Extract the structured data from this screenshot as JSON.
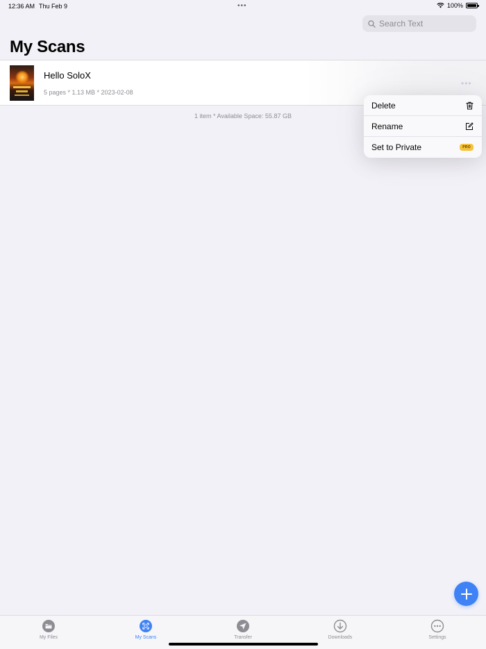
{
  "status_bar": {
    "time": "12:36 AM",
    "date": "Thu Feb 9",
    "battery": "100%"
  },
  "search": {
    "placeholder": "Search Text"
  },
  "page_title": "My Scans",
  "scans": [
    {
      "name": "Hello SoloX",
      "meta": "5 pages * 1.13 MB * 2023-02-08"
    }
  ],
  "footer_info": "1 item * Available Space: 55.87 GB",
  "context_menu": {
    "items": [
      {
        "label": "Delete",
        "icon": "trash-icon"
      },
      {
        "label": "Rename",
        "icon": "edit-icon"
      },
      {
        "label": "Set to Private",
        "badge": "PRO"
      }
    ]
  },
  "tabs": [
    {
      "label": "My Files",
      "icon": "folder-icon",
      "active": false
    },
    {
      "label": "My Scans",
      "icon": "scan-icon",
      "active": true
    },
    {
      "label": "Transfer",
      "icon": "send-icon",
      "active": false
    },
    {
      "label": "Downloads",
      "icon": "download-icon",
      "active": false
    },
    {
      "label": "Settings",
      "icon": "settings-icon",
      "active": false
    }
  ],
  "colors": {
    "accent": "#3e82f6",
    "background": "#f2f1f7",
    "pro_badge": "#f5c23a"
  }
}
